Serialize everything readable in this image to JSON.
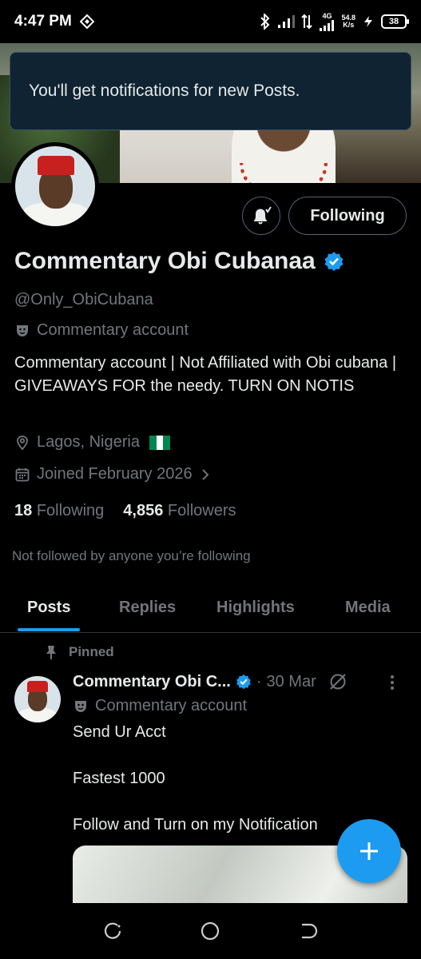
{
  "status_bar": {
    "time": "4:47 PM",
    "network_type": "4G",
    "speed_value": "54.8",
    "speed_unit": "K/s",
    "battery": "38"
  },
  "toast": {
    "message": "You'll get notifications for new Posts."
  },
  "profile": {
    "following_button_label": "Following",
    "display_name": "Commentary Obi Cubanaa",
    "handle": "@Only_ObiCubana",
    "account_label": "Commentary account",
    "bio": "Commentary account | Not Affiliated with Obi cubana | GIVEAWAYS FOR the needy. TURN ON NOTIS",
    "location": "Lagos, Nigeria",
    "joined": "Joined February 2026",
    "following_count": "18",
    "following_label": "Following",
    "followers_count": "4,856",
    "followers_label": "Followers",
    "not_followed_text": "Not followed by anyone you’re following"
  },
  "tabs": [
    {
      "label": "Posts",
      "active": true
    },
    {
      "label": "Replies",
      "active": false
    },
    {
      "label": "Highlights",
      "active": false
    },
    {
      "label": "Media",
      "active": false
    }
  ],
  "post": {
    "pinned_label": "Pinned",
    "author_name": "Commentary Obi C...",
    "separator": "·",
    "date": "30 Mar",
    "author_label": "Commentary account",
    "lines": [
      "Send Ur Acct",
      "Fastest 1000",
      "Follow and Turn on my Notification"
    ]
  },
  "colors": {
    "accent": "#1d9bf0",
    "background": "#000000",
    "secondary_text": "#71767b",
    "toast_background": "#0f2332"
  },
  "icons": {
    "verified": "verified-badge-icon",
    "label": "theater-mask-icon",
    "location": "location-pin-icon",
    "calendar": "calendar-icon",
    "pin": "pin-icon",
    "grok": "slashed-circle-icon",
    "more": "more-vertical-icon",
    "compose": "plus-icon"
  }
}
